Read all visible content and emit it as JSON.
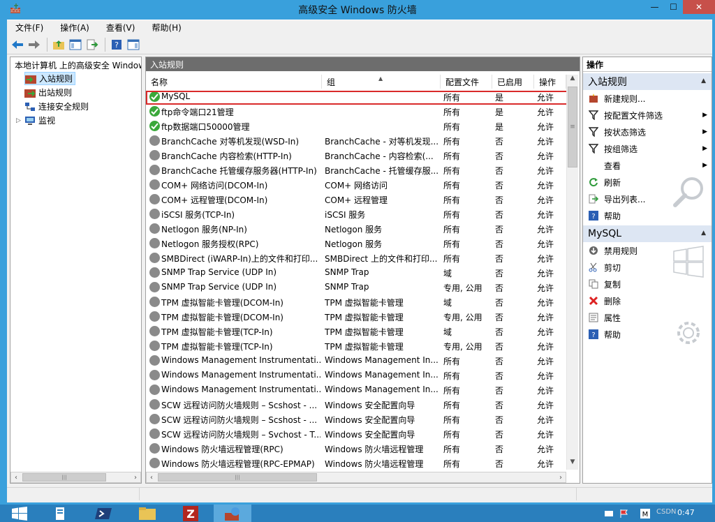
{
  "window": {
    "title": "高级安全 Windows 防火墙",
    "min": "—",
    "max": "☐",
    "close": "✕"
  },
  "menu": [
    "文件(F)",
    "操作(A)",
    "查看(V)",
    "帮助(H)"
  ],
  "tree": {
    "root": "本地计算机 上的高级安全 Windows",
    "items": [
      "入站规则",
      "出站规则",
      "连接安全规则",
      "监视"
    ],
    "selected": "入站规则"
  },
  "center": {
    "pane_title": "入站规则",
    "columns": [
      "名称",
      "组",
      "配置文件",
      "已启用",
      "操作"
    ],
    "rows": [
      {
        "name": "MySQL",
        "group": "",
        "profile": "所有",
        "enabled": "是",
        "action": "允许",
        "on": true
      },
      {
        "name": "ftp命令端口21管理",
        "group": "",
        "profile": "所有",
        "enabled": "是",
        "action": "允许",
        "on": true
      },
      {
        "name": "ftp数据端口50000管理",
        "group": "",
        "profile": "所有",
        "enabled": "是",
        "action": "允许",
        "on": true
      },
      {
        "name": "BranchCache 对等机发现(WSD-In)",
        "group": "BranchCache - 对等机发现...",
        "profile": "所有",
        "enabled": "否",
        "action": "允许",
        "on": false
      },
      {
        "name": "BranchCache 内容检索(HTTP-In)",
        "group": "BranchCache - 内容检索(...",
        "profile": "所有",
        "enabled": "否",
        "action": "允许",
        "on": false
      },
      {
        "name": "BranchCache 托管缓存服务器(HTTP-In)",
        "group": "BranchCache - 托管缓存服...",
        "profile": "所有",
        "enabled": "否",
        "action": "允许",
        "on": false
      },
      {
        "name": "COM+ 网络访问(DCOM-In)",
        "group": "COM+ 网络访问",
        "profile": "所有",
        "enabled": "否",
        "action": "允许",
        "on": false
      },
      {
        "name": "COM+ 远程管理(DCOM-In)",
        "group": "COM+ 远程管理",
        "profile": "所有",
        "enabled": "否",
        "action": "允许",
        "on": false
      },
      {
        "name": "iSCSI 服务(TCP-In)",
        "group": "iSCSI 服务",
        "profile": "所有",
        "enabled": "否",
        "action": "允许",
        "on": false
      },
      {
        "name": "Netlogon 服务(NP-In)",
        "group": "Netlogon 服务",
        "profile": "所有",
        "enabled": "否",
        "action": "允许",
        "on": false
      },
      {
        "name": "Netlogon 服务授权(RPC)",
        "group": "Netlogon 服务",
        "profile": "所有",
        "enabled": "否",
        "action": "允许",
        "on": false
      },
      {
        "name": "SMBDirect (iWARP-In)上的文件和打印...",
        "group": "SMBDirect 上的文件和打印...",
        "profile": "所有",
        "enabled": "否",
        "action": "允许",
        "on": false
      },
      {
        "name": "SNMP Trap Service (UDP In)",
        "group": "SNMP Trap",
        "profile": "域",
        "enabled": "否",
        "action": "允许",
        "on": false
      },
      {
        "name": "SNMP Trap Service (UDP In)",
        "group": "SNMP Trap",
        "profile": "专用, 公用",
        "enabled": "否",
        "action": "允许",
        "on": false
      },
      {
        "name": "TPM 虚拟智能卡管理(DCOM-In)",
        "group": "TPM 虚拟智能卡管理",
        "profile": "域",
        "enabled": "否",
        "action": "允许",
        "on": false
      },
      {
        "name": "TPM 虚拟智能卡管理(DCOM-In)",
        "group": "TPM 虚拟智能卡管理",
        "profile": "专用, 公用",
        "enabled": "否",
        "action": "允许",
        "on": false
      },
      {
        "name": "TPM 虚拟智能卡管理(TCP-In)",
        "group": "TPM 虚拟智能卡管理",
        "profile": "域",
        "enabled": "否",
        "action": "允许",
        "on": false
      },
      {
        "name": "TPM 虚拟智能卡管理(TCP-In)",
        "group": "TPM 虚拟智能卡管理",
        "profile": "专用, 公用",
        "enabled": "否",
        "action": "允许",
        "on": false
      },
      {
        "name": "Windows Management Instrumentati...",
        "group": "Windows Management In...",
        "profile": "所有",
        "enabled": "否",
        "action": "允许",
        "on": false
      },
      {
        "name": "Windows Management Instrumentati...",
        "group": "Windows Management In...",
        "profile": "所有",
        "enabled": "否",
        "action": "允许",
        "on": false
      },
      {
        "name": "Windows Management Instrumentati...",
        "group": "Windows Management In...",
        "profile": "所有",
        "enabled": "否",
        "action": "允许",
        "on": false
      },
      {
        "name": "SCW 远程访问防火墙规则 – Scshost - ...",
        "group": "Windows 安全配置向导",
        "profile": "所有",
        "enabled": "否",
        "action": "允许",
        "on": false
      },
      {
        "name": "SCW 远程访问防火墙规则 – Scshost - ...",
        "group": "Windows 安全配置向导",
        "profile": "所有",
        "enabled": "否",
        "action": "允许",
        "on": false
      },
      {
        "name": "SCW 远程访问防火墙规则 – Svchost - T...",
        "group": "Windows 安全配置向导",
        "profile": "所有",
        "enabled": "否",
        "action": "允许",
        "on": false
      },
      {
        "name": "Windows 防火墙远程管理(RPC)",
        "group": "Windows 防火墙远程管理",
        "profile": "所有",
        "enabled": "否",
        "action": "允许",
        "on": false
      },
      {
        "name": "Windows 防火墙远程管理(RPC-EPMAP)",
        "group": "Windows 防火墙远程管理",
        "profile": "所有",
        "enabled": "否",
        "action": "允许",
        "on": false
      }
    ]
  },
  "actions": {
    "title": "操作",
    "section1": "入站规则",
    "section1_items": [
      {
        "label": "新建规则...",
        "icon": "new-rule-icon",
        "sub": false
      },
      {
        "label": "按配置文件筛选",
        "icon": "filter-icon",
        "sub": true
      },
      {
        "label": "按状态筛选",
        "icon": "filter-icon",
        "sub": true
      },
      {
        "label": "按组筛选",
        "icon": "filter-icon",
        "sub": true
      },
      {
        "label": "查看",
        "icon": "",
        "sub": true
      },
      {
        "label": "刷新",
        "icon": "refresh-icon",
        "sub": false
      },
      {
        "label": "导出列表...",
        "icon": "export-icon",
        "sub": false
      },
      {
        "label": "帮助",
        "icon": "help-icon",
        "sub": false
      }
    ],
    "section2": "MySQL",
    "section2_items": [
      {
        "label": "禁用规则",
        "icon": "disable-icon"
      },
      {
        "label": "剪切",
        "icon": "cut-icon"
      },
      {
        "label": "复制",
        "icon": "copy-icon"
      },
      {
        "label": "删除",
        "icon": "delete-icon"
      },
      {
        "label": "属性",
        "icon": "properties-icon"
      },
      {
        "label": "帮助",
        "icon": "help-icon"
      }
    ]
  },
  "taskbar": {
    "clock": "0:47",
    "watermark": "CSDN"
  },
  "colors": {
    "title_bar": "#39a0dc",
    "selected": "#cce8ff",
    "highlight_border": "#d92a2a",
    "enabled_icon": "#3aa83a",
    "disabled_icon": "#8a8a8a",
    "section_bg": "#dde6f3"
  }
}
